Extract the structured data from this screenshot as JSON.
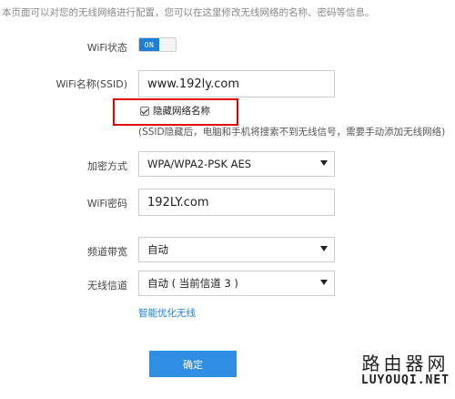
{
  "intro_text": "本页面可以对您的无线网络进行配置，您可以在这里修改无线网络的名称、密码等信息。",
  "wifi_status": {
    "label": "WiFi状态",
    "toggle_text": "ON",
    "enabled": true
  },
  "wifi_name": {
    "label": "WiFi名称(SSID)",
    "value": "www.192ly.com"
  },
  "hide_network": {
    "label": "隐藏网络名称",
    "checked": true,
    "hint": "(SSID隐藏后，电脑和手机将搜索不到无线信号，需要手动添加无线网络)"
  },
  "encryption": {
    "label": "加密方式",
    "selected": "WPA/WPA2-PSK AES"
  },
  "wifi_password": {
    "label": "WiFi密码",
    "value": "192LY.com"
  },
  "bandwidth": {
    "label": "频道带宽",
    "selected": "自动"
  },
  "channel": {
    "label": "无线信道",
    "selected": "自动 ( 当前信道 3 )"
  },
  "smart_optimize_link": "智能优化无线",
  "confirm_button": "确定",
  "watermark": {
    "line1": "路由器网",
    "line2": "LUYOUQI.NET"
  },
  "colors": {
    "accent": "#2f8de4",
    "toggle_on": "#1e7fd6",
    "highlight": "#e00000",
    "link": "#1e7fd6"
  }
}
